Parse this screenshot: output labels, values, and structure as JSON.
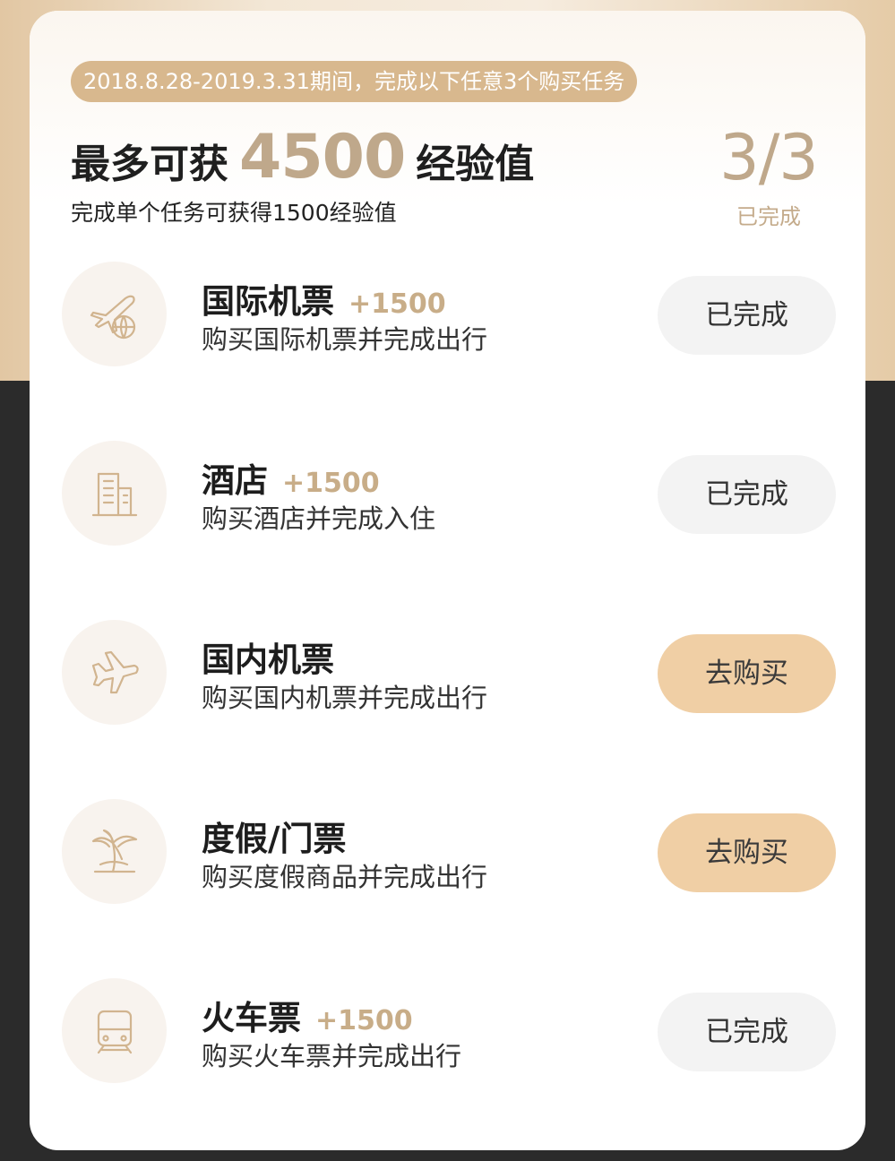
{
  "header": {
    "period": "2018.8.28-2019.3.31期间，完成以下任意3个购买任务",
    "headline_pre": "最多可获",
    "headline_value": "4500",
    "headline_post": "经验值",
    "subline": "完成单个任务可获得1500经验值",
    "progress_value": "3/3",
    "progress_label": "已完成"
  },
  "tasks": [
    {
      "title": "国际机票",
      "points": "+1500",
      "desc": "购买国际机票并完成出行",
      "button": "已完成",
      "status": "done",
      "icon": "plane-globe-icon"
    },
    {
      "title": "酒店",
      "points": "+1500",
      "desc": "购买酒店并完成入住",
      "button": "已完成",
      "status": "done",
      "icon": "building-icon"
    },
    {
      "title": "国内机票",
      "points": "",
      "desc": "购买国内机票并完成出行",
      "button": "去购买",
      "status": "todo",
      "icon": "plane-icon"
    },
    {
      "title": "度假/门票",
      "points": "",
      "desc": "购买度假商品并完成出行",
      "button": "去购买",
      "status": "todo",
      "icon": "palm-tree-icon"
    },
    {
      "title": "火车票",
      "points": "+1500",
      "desc": "购买火车票并完成出行",
      "button": "已完成",
      "status": "done",
      "icon": "train-icon"
    }
  ],
  "colors": {
    "accent_gold": "#bfa88b",
    "badge_bg": "#d8b88e",
    "buy_button_bg": "#f0cfa5",
    "done_button_bg": "#f3f3f3"
  }
}
